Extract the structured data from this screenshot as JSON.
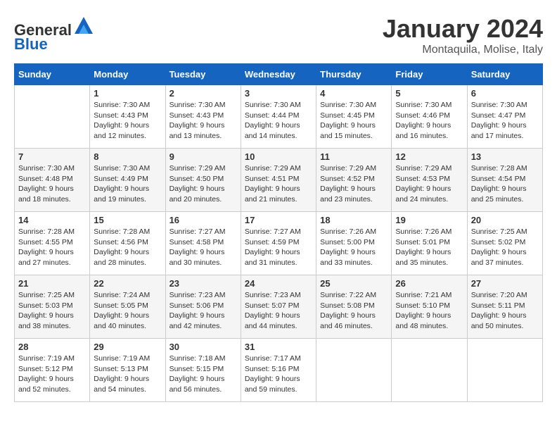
{
  "header": {
    "logo_general": "General",
    "logo_blue": "Blue",
    "month_title": "January 2024",
    "location": "Montaquila, Molise, Italy"
  },
  "days_of_week": [
    "Sunday",
    "Monday",
    "Tuesday",
    "Wednesday",
    "Thursday",
    "Friday",
    "Saturday"
  ],
  "weeks": [
    [
      {
        "day": "",
        "info": ""
      },
      {
        "day": "1",
        "info": "Sunrise: 7:30 AM\nSunset: 4:43 PM\nDaylight: 9 hours\nand 12 minutes."
      },
      {
        "day": "2",
        "info": "Sunrise: 7:30 AM\nSunset: 4:43 PM\nDaylight: 9 hours\nand 13 minutes."
      },
      {
        "day": "3",
        "info": "Sunrise: 7:30 AM\nSunset: 4:44 PM\nDaylight: 9 hours\nand 14 minutes."
      },
      {
        "day": "4",
        "info": "Sunrise: 7:30 AM\nSunset: 4:45 PM\nDaylight: 9 hours\nand 15 minutes."
      },
      {
        "day": "5",
        "info": "Sunrise: 7:30 AM\nSunset: 4:46 PM\nDaylight: 9 hours\nand 16 minutes."
      },
      {
        "day": "6",
        "info": "Sunrise: 7:30 AM\nSunset: 4:47 PM\nDaylight: 9 hours\nand 17 minutes."
      }
    ],
    [
      {
        "day": "7",
        "info": "Sunrise: 7:30 AM\nSunset: 4:48 PM\nDaylight: 9 hours\nand 18 minutes."
      },
      {
        "day": "8",
        "info": "Sunrise: 7:30 AM\nSunset: 4:49 PM\nDaylight: 9 hours\nand 19 minutes."
      },
      {
        "day": "9",
        "info": "Sunrise: 7:29 AM\nSunset: 4:50 PM\nDaylight: 9 hours\nand 20 minutes."
      },
      {
        "day": "10",
        "info": "Sunrise: 7:29 AM\nSunset: 4:51 PM\nDaylight: 9 hours\nand 21 minutes."
      },
      {
        "day": "11",
        "info": "Sunrise: 7:29 AM\nSunset: 4:52 PM\nDaylight: 9 hours\nand 23 minutes."
      },
      {
        "day": "12",
        "info": "Sunrise: 7:29 AM\nSunset: 4:53 PM\nDaylight: 9 hours\nand 24 minutes."
      },
      {
        "day": "13",
        "info": "Sunrise: 7:28 AM\nSunset: 4:54 PM\nDaylight: 9 hours\nand 25 minutes."
      }
    ],
    [
      {
        "day": "14",
        "info": "Sunrise: 7:28 AM\nSunset: 4:55 PM\nDaylight: 9 hours\nand 27 minutes."
      },
      {
        "day": "15",
        "info": "Sunrise: 7:28 AM\nSunset: 4:56 PM\nDaylight: 9 hours\nand 28 minutes."
      },
      {
        "day": "16",
        "info": "Sunrise: 7:27 AM\nSunset: 4:58 PM\nDaylight: 9 hours\nand 30 minutes."
      },
      {
        "day": "17",
        "info": "Sunrise: 7:27 AM\nSunset: 4:59 PM\nDaylight: 9 hours\nand 31 minutes."
      },
      {
        "day": "18",
        "info": "Sunrise: 7:26 AM\nSunset: 5:00 PM\nDaylight: 9 hours\nand 33 minutes."
      },
      {
        "day": "19",
        "info": "Sunrise: 7:26 AM\nSunset: 5:01 PM\nDaylight: 9 hours\nand 35 minutes."
      },
      {
        "day": "20",
        "info": "Sunrise: 7:25 AM\nSunset: 5:02 PM\nDaylight: 9 hours\nand 37 minutes."
      }
    ],
    [
      {
        "day": "21",
        "info": "Sunrise: 7:25 AM\nSunset: 5:03 PM\nDaylight: 9 hours\nand 38 minutes."
      },
      {
        "day": "22",
        "info": "Sunrise: 7:24 AM\nSunset: 5:05 PM\nDaylight: 9 hours\nand 40 minutes."
      },
      {
        "day": "23",
        "info": "Sunrise: 7:23 AM\nSunset: 5:06 PM\nDaylight: 9 hours\nand 42 minutes."
      },
      {
        "day": "24",
        "info": "Sunrise: 7:23 AM\nSunset: 5:07 PM\nDaylight: 9 hours\nand 44 minutes."
      },
      {
        "day": "25",
        "info": "Sunrise: 7:22 AM\nSunset: 5:08 PM\nDaylight: 9 hours\nand 46 minutes."
      },
      {
        "day": "26",
        "info": "Sunrise: 7:21 AM\nSunset: 5:10 PM\nDaylight: 9 hours\nand 48 minutes."
      },
      {
        "day": "27",
        "info": "Sunrise: 7:20 AM\nSunset: 5:11 PM\nDaylight: 9 hours\nand 50 minutes."
      }
    ],
    [
      {
        "day": "28",
        "info": "Sunrise: 7:19 AM\nSunset: 5:12 PM\nDaylight: 9 hours\nand 52 minutes."
      },
      {
        "day": "29",
        "info": "Sunrise: 7:19 AM\nSunset: 5:13 PM\nDaylight: 9 hours\nand 54 minutes."
      },
      {
        "day": "30",
        "info": "Sunrise: 7:18 AM\nSunset: 5:15 PM\nDaylight: 9 hours\nand 56 minutes."
      },
      {
        "day": "31",
        "info": "Sunrise: 7:17 AM\nSunset: 5:16 PM\nDaylight: 9 hours\nand 59 minutes."
      },
      {
        "day": "",
        "info": ""
      },
      {
        "day": "",
        "info": ""
      },
      {
        "day": "",
        "info": ""
      }
    ]
  ]
}
